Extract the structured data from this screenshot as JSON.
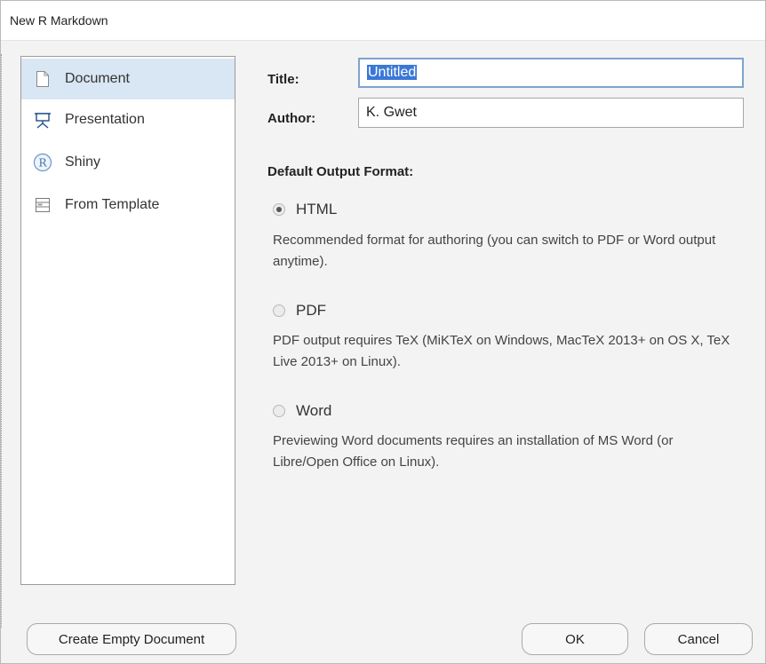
{
  "window": {
    "title": "New R Markdown"
  },
  "sidebar": {
    "items": [
      {
        "label": "Document",
        "icon": "document-icon",
        "selected": true
      },
      {
        "label": "Presentation",
        "icon": "presentation-icon",
        "selected": false
      },
      {
        "label": "Shiny",
        "icon": "shiny-r-icon",
        "selected": false
      },
      {
        "label": "From Template",
        "icon": "template-icon",
        "selected": false
      }
    ]
  },
  "form": {
    "title_label": "Title:",
    "title_value": "Untitled",
    "author_label": "Author:",
    "author_value": "K. Gwet"
  },
  "output": {
    "heading": "Default Output Format:",
    "options": [
      {
        "label": "HTML",
        "checked": true,
        "description": "Recommended format for authoring (you can switch to PDF or Word output anytime)."
      },
      {
        "label": "PDF",
        "checked": false,
        "description": "PDF output requires TeX (MiKTeX on Windows, MacTeX 2013+ on OS X, TeX Live 2013+ on Linux)."
      },
      {
        "label": "Word",
        "checked": false,
        "description": "Previewing Word documents requires an installation of MS Word (or Libre/Open Office on Linux)."
      }
    ]
  },
  "buttons": {
    "create_empty": "Create Empty Document",
    "ok": "OK",
    "cancel": "Cancel"
  },
  "colors": {
    "selection_bg": "#d9e6f3",
    "text_selection": "#3a78d6",
    "focus_border": "#7ea3cf"
  }
}
